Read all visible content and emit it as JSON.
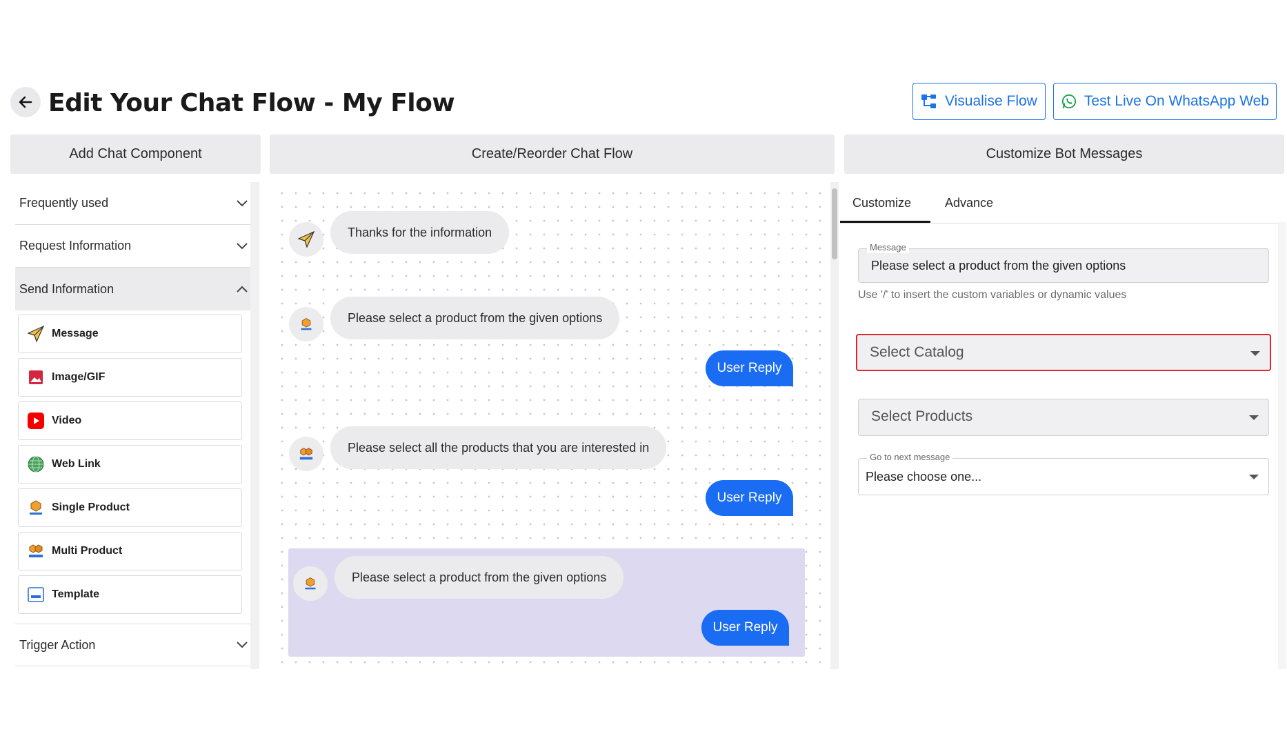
{
  "header": {
    "title": "Edit Your Chat Flow - My Flow",
    "visualise_label": "Visualise Flow",
    "test_label": "Test Live On WhatsApp Web",
    "accent_color": "#1a73e8"
  },
  "panels": {
    "left_title": "Add Chat Component",
    "middle_title": "Create/Reorder Chat Flow",
    "right_title": "Customize Bot Messages"
  },
  "sidebar": {
    "sections": [
      {
        "label": "Frequently used",
        "expanded": false
      },
      {
        "label": "Request Information",
        "expanded": false
      },
      {
        "label": "Send Information",
        "expanded": true
      },
      {
        "label": "Trigger Action",
        "expanded": false
      }
    ],
    "components": [
      {
        "label": "Message",
        "icon": "paper-plane-icon"
      },
      {
        "label": "Image/GIF",
        "icon": "image-icon"
      },
      {
        "label": "Video",
        "icon": "youtube-icon"
      },
      {
        "label": "Web Link",
        "icon": "globe-icon"
      },
      {
        "label": "Single Product",
        "icon": "single-product-icon"
      },
      {
        "label": "Multi Product",
        "icon": "multi-product-icon"
      },
      {
        "label": "Template",
        "icon": "template-icon"
      }
    ]
  },
  "flow": {
    "messages": [
      {
        "text": "Thanks for the information",
        "icon": "paper-plane-icon"
      },
      {
        "text": "Please select a product from the given options",
        "icon": "single-product-icon"
      },
      {
        "text": "Please select all the products that you are interested in",
        "icon": "multi-product-icon"
      },
      {
        "text": "Please select a product from the given options",
        "icon": "single-product-icon"
      }
    ],
    "reply_label": "User Reply",
    "reply_color": "#1a6df2",
    "selected_color": "#ddd9f0"
  },
  "customize": {
    "tabs": [
      "Customize",
      "Advance"
    ],
    "active_tab": "Customize",
    "message_label": "Message",
    "message_value": "Please select a product from the given options",
    "helper_text": "Use '/' to insert the custom variables or dynamic values",
    "catalog_placeholder": "Select Catalog",
    "products_placeholder": "Select Products",
    "next_label": "Go to next message",
    "next_value": "Please choose one...",
    "highlight_color": "#e0242c"
  }
}
